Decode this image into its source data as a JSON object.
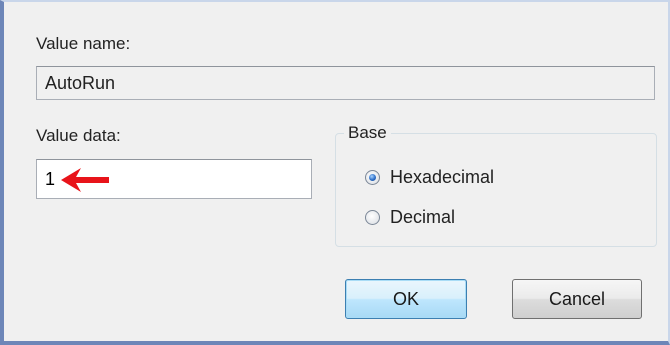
{
  "dialog": {
    "value_name_label": "Value name:",
    "value_name": "AutoRun",
    "value_data_label": "Value data:",
    "value_data": "1",
    "base": {
      "label": "Base",
      "options": [
        "Hexadecimal",
        "Decimal"
      ],
      "selected": "Hexadecimal"
    },
    "ok_label": "OK",
    "cancel_label": "Cancel"
  },
  "annotation": {
    "arrow_icon": "red-arrow-left-icon",
    "color": "#e8141a"
  }
}
